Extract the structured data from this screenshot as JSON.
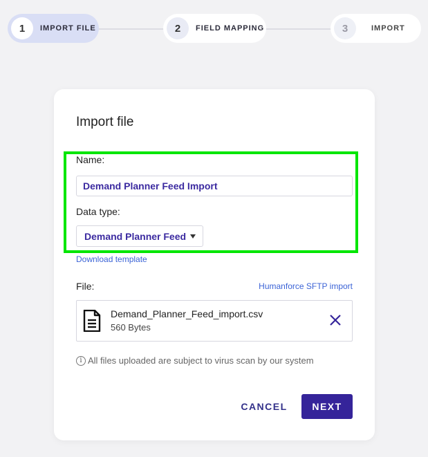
{
  "stepper": {
    "steps": [
      {
        "number": "1",
        "label": "IMPORT FILE",
        "state": "active"
      },
      {
        "number": "2",
        "label": "FIELD MAPPING",
        "state": "done"
      },
      {
        "number": "3",
        "label": "IMPORT",
        "state": "pending"
      }
    ]
  },
  "dialog": {
    "title": "Import file",
    "name_label": "Name:",
    "name_value": "Demand Planner Feed Import",
    "data_type_label": "Data type:",
    "data_type_value": "Demand Planner Feed",
    "download_template": "Download template",
    "file_label": "File:",
    "sftp_link": "Humanforce SFTP import",
    "file": {
      "name": "Demand_Planner_Feed_import.csv",
      "size": "560 Bytes",
      "icon": "document-icon"
    },
    "notice": "All files uploaded are subject to virus scan by our system",
    "notice_icon": "i",
    "cancel_label": "CANCEL",
    "next_label": "NEXT"
  },
  "colors": {
    "accent": "#35249a",
    "highlight": "#00e600",
    "link": "#3b63d6"
  }
}
